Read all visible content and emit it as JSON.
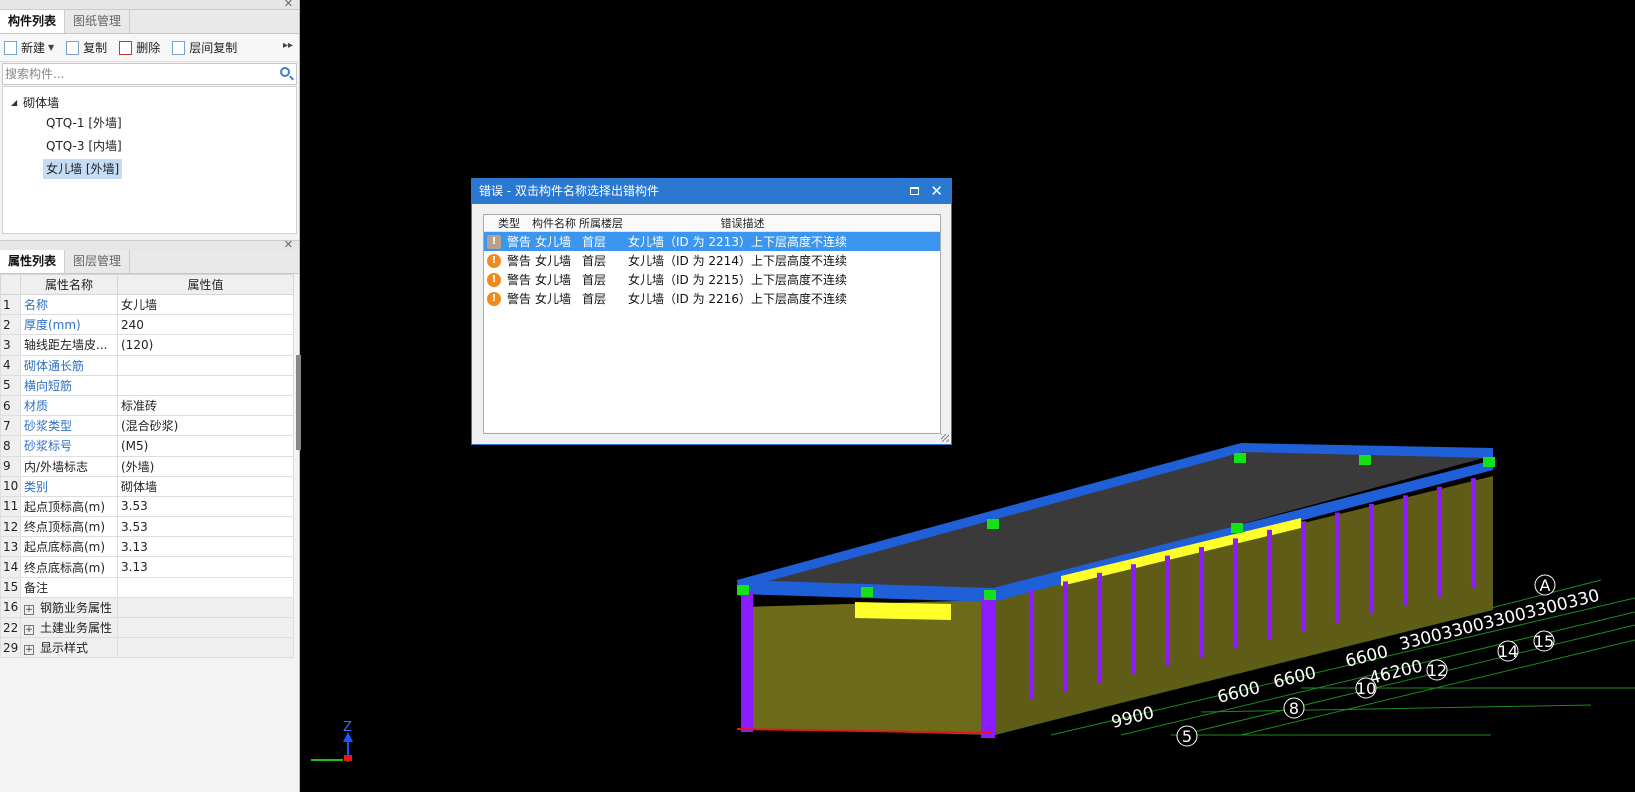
{
  "component_panel": {
    "tabs": [
      "构件列表",
      "图纸管理"
    ],
    "toolbar": {
      "new_label": "新建",
      "copy_label": "复制",
      "delete_label": "删除",
      "floor_copy_label": "层间复制"
    },
    "search": {
      "placeholder": "搜索构件..."
    },
    "tree": {
      "root_label": "砌体墙",
      "items": [
        "QTQ-1 [外墙]",
        "QTQ-3 [内墙]",
        "女儿墙 [外墙]"
      ],
      "selected_index": 2
    }
  },
  "property_panel": {
    "tabs": [
      "属性列表",
      "图层管理"
    ],
    "headers": {
      "name": "属性名称",
      "value": "属性值"
    },
    "rows": [
      {
        "num": "1",
        "name": "名称",
        "value": "女儿墙",
        "blue": true
      },
      {
        "num": "2",
        "name": "厚度(mm)",
        "value": "240",
        "blue": true
      },
      {
        "num": "3",
        "name": "轴线距左墙皮...",
        "value": "(120)",
        "blue": false
      },
      {
        "num": "4",
        "name": "砌体通长筋",
        "value": "",
        "blue": true
      },
      {
        "num": "5",
        "name": "横向短筋",
        "value": "",
        "blue": true
      },
      {
        "num": "6",
        "name": "材质",
        "value": "标准砖",
        "blue": true
      },
      {
        "num": "7",
        "name": "砂浆类型",
        "value": "(混合砂浆)",
        "blue": true
      },
      {
        "num": "8",
        "name": "砂浆标号",
        "value": "(M5)",
        "blue": true
      },
      {
        "num": "9",
        "name": "内/外墙标志",
        "value": "(外墙)",
        "blue": false
      },
      {
        "num": "10",
        "name": "类别",
        "value": "砌体墙",
        "blue": true
      },
      {
        "num": "11",
        "name": "起点顶标高(m)",
        "value": "3.53",
        "blue": false
      },
      {
        "num": "12",
        "name": "终点顶标高(m)",
        "value": "3.53",
        "blue": false
      },
      {
        "num": "13",
        "name": "起点底标高(m)",
        "value": "3.13",
        "blue": false
      },
      {
        "num": "14",
        "name": "终点底标高(m)",
        "value": "3.13",
        "blue": false
      },
      {
        "num": "15",
        "name": "备注",
        "value": "",
        "blue": false
      }
    ],
    "groups": [
      {
        "num": "16",
        "name": "钢筋业务属性"
      },
      {
        "num": "22",
        "name": "土建业务属性"
      },
      {
        "num": "29",
        "name": "显示样式"
      }
    ]
  },
  "error_dialog": {
    "title": "错误 - 双击构件名称选择出错构件",
    "columns": [
      "类型",
      "构件名称",
      "所属楼层",
      "错误描述"
    ],
    "rows": [
      {
        "type": "警告",
        "name": "女儿墙",
        "floor": "首层",
        "desc": "女儿墙（ID 为 2213）上下层高度不连续",
        "selected": true
      },
      {
        "type": "警告",
        "name": "女儿墙",
        "floor": "首层",
        "desc": "女儿墙（ID 为 2214）上下层高度不连续",
        "selected": false
      },
      {
        "type": "警告",
        "name": "女儿墙",
        "floor": "首层",
        "desc": "女儿墙（ID 为 2215）上下层高度不连续",
        "selected": false
      },
      {
        "type": "警告",
        "name": "女儿墙",
        "floor": "首层",
        "desc": "女儿墙（ID 为 2216）上下层高度不连续",
        "selected": false
      }
    ]
  },
  "viewport": {
    "dimensions": [
      "9900",
      "6600",
      "6600",
      "6600",
      "46200",
      "3300330033003300330"
    ],
    "axis_labels": [
      "A",
      "5",
      "8",
      "10",
      "12",
      "14",
      "15"
    ],
    "gizmo_label": "Z",
    "colors": {
      "roof": "#1f5fd8",
      "slab": "#3a3a3a",
      "wall": "#6d6a1a",
      "column": "#8b1cff",
      "beam": "#ffff2a",
      "marker": "#16e016",
      "grid": "#1c8c1c"
    }
  }
}
